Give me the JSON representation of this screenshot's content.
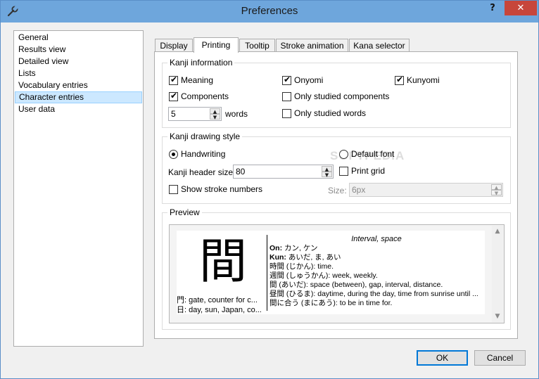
{
  "window": {
    "title": "Preferences",
    "help_glyph": "?",
    "close_glyph": "✕"
  },
  "sidebar": {
    "items": [
      {
        "label": "General"
      },
      {
        "label": "Results view"
      },
      {
        "label": "Detailed view"
      },
      {
        "label": "Lists"
      },
      {
        "label": "Vocabulary entries"
      },
      {
        "label": "Character entries",
        "selected": true
      },
      {
        "label": "User data"
      }
    ]
  },
  "tabs": [
    {
      "label": "Display"
    },
    {
      "label": "Printing",
      "active": true
    },
    {
      "label": "Tooltip"
    },
    {
      "label": "Stroke animation"
    },
    {
      "label": "Kana selector"
    }
  ],
  "kanji_info": {
    "label": "Kanji information",
    "meaning": {
      "label": "Meaning",
      "checked": true
    },
    "onyomi": {
      "label": "Onyomi",
      "checked": true
    },
    "kunyomi": {
      "label": "Kunyomi",
      "checked": true
    },
    "components": {
      "label": "Components",
      "checked": true
    },
    "only_studied_components": {
      "label": "Only studied components",
      "checked": false
    },
    "words_count": "5",
    "words_label": "words",
    "only_studied_words": {
      "label": "Only studied words",
      "checked": false
    }
  },
  "drawing_style": {
    "label": "Kanji drawing style",
    "handwriting": {
      "label": "Handwriting",
      "selected": true
    },
    "default_font": {
      "label": "Default font",
      "selected": false
    },
    "header_size_label": "Kanji header size:",
    "header_size_value": "80",
    "print_grid": {
      "label": "Print grid",
      "checked": false
    },
    "show_stroke_numbers": {
      "label": "Show stroke numbers",
      "checked": false
    },
    "size_label": "Size:",
    "size_value": "6px"
  },
  "preview": {
    "label": "Preview",
    "kanji": "間",
    "components": [
      "門: gate, counter for c...",
      "日: day, sun, Japan, co..."
    ],
    "meaning": "Interval, space",
    "on_label": "On:",
    "on_value": " カン, ケン",
    "kun_label": "Kun:",
    "kun_value": " あいだ, ま, あい",
    "words": [
      "時間 (じかん): time.",
      "週間 (しゅうかん): week, weekly.",
      "間 (あいだ): space (between), gap, interval, distance.",
      "昼間 (ひるま): daytime, during the day, time from sunrise until ...",
      "間に合う (まにあう): to be in time for."
    ]
  },
  "buttons": {
    "ok": "OK",
    "cancel": "Cancel"
  },
  "watermark": "SOFTPEDIA"
}
